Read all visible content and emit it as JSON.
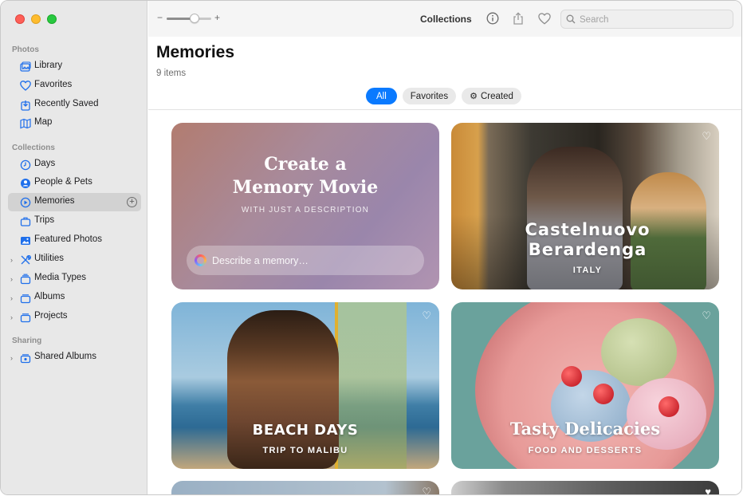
{
  "window": {
    "toolbar_title": "Collections",
    "search_placeholder": "Search",
    "zoom": {
      "minus": "−",
      "plus": "+",
      "level": 0.6
    }
  },
  "sidebar": {
    "sections": [
      {
        "title": "Photos",
        "items": [
          {
            "label": "Library",
            "icon": "library-icon"
          },
          {
            "label": "Favorites",
            "icon": "heart-icon"
          },
          {
            "label": "Recently Saved",
            "icon": "recently-saved-icon"
          },
          {
            "label": "Map",
            "icon": "map-icon"
          }
        ]
      },
      {
        "title": "Collections",
        "items": [
          {
            "label": "Days",
            "icon": "clock-icon"
          },
          {
            "label": "People & Pets",
            "icon": "person-icon"
          },
          {
            "label": "Memories",
            "icon": "memories-icon",
            "selected": true
          },
          {
            "label": "Trips",
            "icon": "suitcase-icon"
          },
          {
            "label": "Featured Photos",
            "icon": "photo-icon"
          },
          {
            "label": "Utilities",
            "icon": "tools-icon",
            "expandable": true
          },
          {
            "label": "Media Types",
            "icon": "stack-icon",
            "expandable": true
          },
          {
            "label": "Albums",
            "icon": "album-icon",
            "expandable": true
          },
          {
            "label": "Projects",
            "icon": "folder-icon",
            "expandable": true
          }
        ]
      },
      {
        "title": "Sharing",
        "items": [
          {
            "label": "Shared Albums",
            "icon": "shared-album-icon",
            "expandable": true
          }
        ]
      }
    ]
  },
  "main": {
    "title": "Memories",
    "count": "9 items",
    "filters": [
      {
        "label": "All",
        "active": true
      },
      {
        "label": "Favorites",
        "active": false
      },
      {
        "label": "Created",
        "active": false
      }
    ],
    "create_card": {
      "title_line1": "Create a",
      "title_line2": "Memory Movie",
      "subtitle": "WITH JUST A DESCRIPTION",
      "input_placeholder": "Describe a memory…"
    },
    "memories": [
      {
        "title_line1": "Castelnuovo",
        "title_line2": "Berardenga",
        "subtitle": "ITALY"
      },
      {
        "title": "BEACH DAYS",
        "subtitle": "TRIP TO MALIBU"
      },
      {
        "title": "Tasty Delicacies",
        "subtitle": "FOOD AND DESSERTS"
      }
    ]
  },
  "colors": {
    "accent": "#0a7aff",
    "sidebar_bg": "#e8e8e8",
    "sidebar_icon": "#1f6feb",
    "close": "#fe5f57",
    "minimize": "#febc2e",
    "maximize": "#28c840"
  }
}
